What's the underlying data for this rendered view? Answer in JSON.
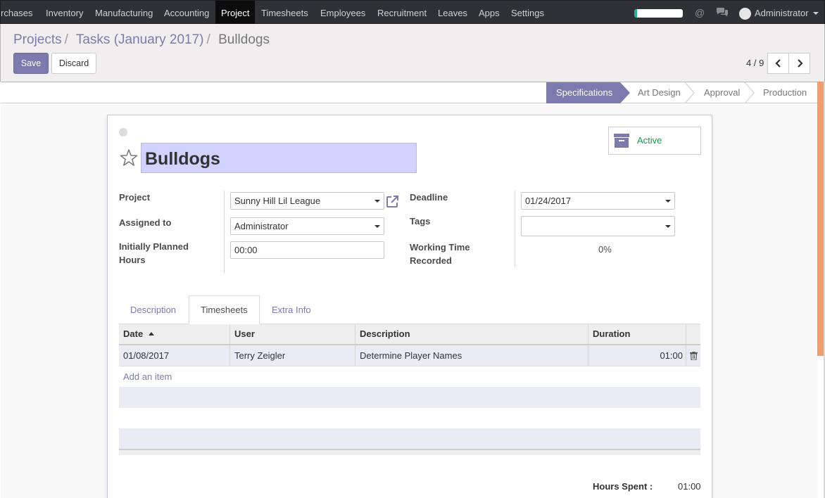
{
  "nav": {
    "items": [
      "rchases",
      "Inventory",
      "Manufacturing",
      "Accounting",
      "Project",
      "Timesheets",
      "Employees",
      "Recruitment",
      "Leaves",
      "Apps",
      "Settings"
    ],
    "active": "Project",
    "user": "Administrator",
    "icons": [
      "at-icon",
      "chat-icon"
    ]
  },
  "breadcrumb": {
    "items": [
      "Projects",
      "Tasks (January 2017)",
      "Bulldogs"
    ]
  },
  "actions": {
    "save": "Save",
    "discard": "Discard"
  },
  "pager": {
    "text": "4 / 9"
  },
  "stages": {
    "items": [
      "Specifications",
      "Art Design",
      "Approval",
      "Production"
    ],
    "current": "Specifications",
    "current_color": "#7c7bad"
  },
  "task": {
    "name": "Bulldogs",
    "status": "Active",
    "fields": {
      "project_label": "Project",
      "project_value": "Sunny Hill Lil League",
      "assigned_label": "Assigned to",
      "assigned_value": "Administrator",
      "planned_label_1": "Initially Planned",
      "planned_label_2": "Hours",
      "planned_value": "00:00",
      "deadline_label": "Deadline",
      "deadline_value": "01/24/2017",
      "tags_label": "Tags",
      "tags_value": "",
      "working_label_1": "Working Time",
      "working_label_2": "Recorded",
      "working_value": "0%"
    }
  },
  "tabs": {
    "items": [
      "Description",
      "Timesheets",
      "Extra Info"
    ],
    "active": "Timesheets"
  },
  "timesheet": {
    "columns": [
      "Date",
      "User",
      "Description",
      "Duration"
    ],
    "rows": [
      {
        "date": "01/08/2017",
        "user": "Terry Zeigler",
        "description": "Determine Player Names",
        "duration": "01:00"
      }
    ],
    "add_item": "Add an item"
  },
  "summary": {
    "hours_spent_label": "Hours Spent :",
    "hours_spent_value": "01:00"
  }
}
